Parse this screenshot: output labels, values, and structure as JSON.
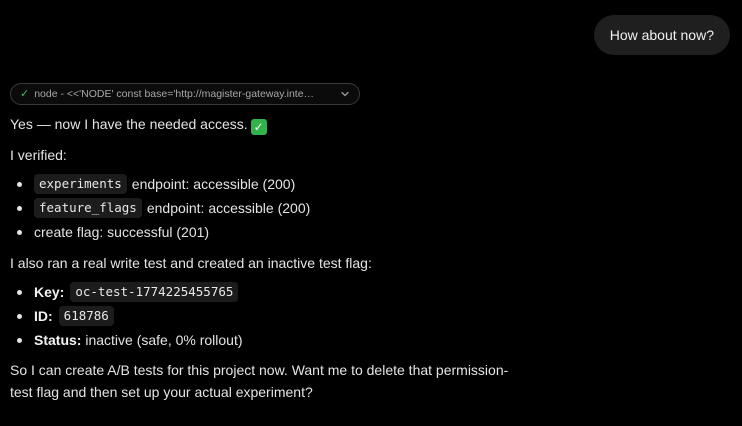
{
  "user_message": "How about now?",
  "tool_call": {
    "command_preview": "node - <<'NODE' const base='http://magister-gateway.inte…"
  },
  "assistant": {
    "intro": "Yes — now I have the needed access.",
    "verified_heading": "I verified:",
    "verified_items": [
      {
        "code": "experiments",
        "text": "endpoint: accessible (200)"
      },
      {
        "code": "feature_flags",
        "text": "endpoint: accessible (200)"
      },
      {
        "text": "create flag: successful (201)"
      }
    ],
    "write_test_heading": "I also ran a real write test and created an inactive test flag:",
    "flag_items": [
      {
        "label": "Key:",
        "code": "oc-test-1774225455765"
      },
      {
        "label": "ID:",
        "code": "618786"
      },
      {
        "label": "Status:",
        "text": "inactive (safe, 0% rollout)"
      }
    ],
    "closing_line_1": "So I can create A/B tests for this project now. Want me to delete that permission-",
    "closing_line_2": "test flag and then set up your actual experiment?"
  }
}
